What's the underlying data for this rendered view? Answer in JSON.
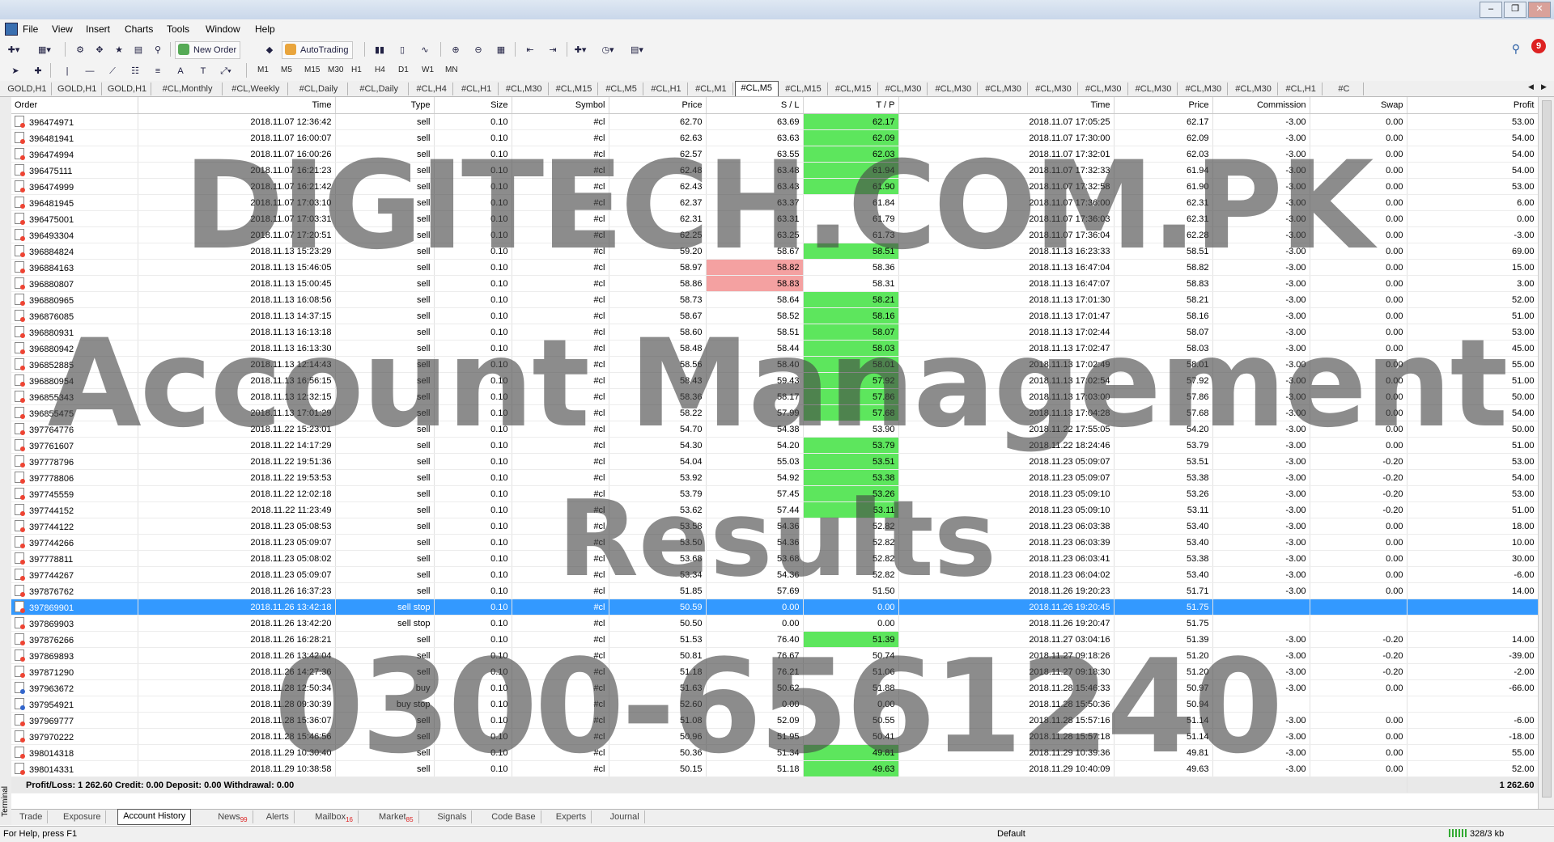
{
  "menu": [
    "File",
    "View",
    "Insert",
    "Charts",
    "Tools",
    "Window",
    "Help"
  ],
  "toolbar": {
    "new_order": "New Order",
    "autotrading": "AutoTrading"
  },
  "timeframes": [
    "M1",
    "M5",
    "M15",
    "M30",
    "H1",
    "H4",
    "D1",
    "W1",
    "MN"
  ],
  "notification_count": "9",
  "chart_tabs": [
    "GOLD,H1",
    "GOLD,H1",
    "GOLD,H1",
    "#CL,Monthly",
    "#CL,Weekly",
    "#CL,Daily",
    "#CL,Daily",
    "#CL,H4",
    "#CL,H1",
    "#CL,M30",
    "#CL,M15",
    "#CL,M5",
    "#CL,H1",
    "#CL,M1",
    "#CL,M5",
    "#CL,M15",
    "#CL,M15",
    "#CL,M30",
    "#CL,M30",
    "#CL,M30",
    "#CL,M30",
    "#CL,M30",
    "#CL,M30",
    "#CL,M30",
    "#CL,M30",
    "#CL,H1",
    "#C"
  ],
  "active_chart_tab": 14,
  "columns": [
    "Order",
    "Time",
    "Type",
    "Size",
    "Symbol",
    "Price",
    "S / L",
    "T / P",
    "Time",
    "Price",
    "Commission",
    "Swap",
    "Profit"
  ],
  "rows": [
    [
      "396474971",
      "2018.11.07 12:36:42",
      "sell",
      "0.10",
      "#cl",
      "62.70",
      "63.69",
      "62.17",
      "2018.11.07 17:05:25",
      "62.17",
      "-3.00",
      "0.00",
      "53.00"
    ],
    [
      "396481941",
      "2018.11.07 16:00:07",
      "sell",
      "0.10",
      "#cl",
      "62.63",
      "63.63",
      "62.09",
      "2018.11.07 17:30:00",
      "62.09",
      "-3.00",
      "0.00",
      "54.00"
    ],
    [
      "396474994",
      "2018.11.07 16:00:26",
      "sell",
      "0.10",
      "#cl",
      "62.57",
      "63.55",
      "62.03",
      "2018.11.07 17:32:01",
      "62.03",
      "-3.00",
      "0.00",
      "54.00"
    ],
    [
      "396475111",
      "2018.11.07 16:21:23",
      "sell",
      "0.10",
      "#cl",
      "62.48",
      "63.48",
      "61.94",
      "2018.11.07 17:32:33",
      "61.94",
      "-3.00",
      "0.00",
      "54.00"
    ],
    [
      "396474999",
      "2018.11.07 16:21:42",
      "sell",
      "0.10",
      "#cl",
      "62.43",
      "63.43",
      "61.90",
      "2018.11.07 17:32:58",
      "61.90",
      "-3.00",
      "0.00",
      "53.00"
    ],
    [
      "396481945",
      "2018.11.07 17:03:10",
      "sell",
      "0.10",
      "#cl",
      "62.37",
      "63.37",
      "61.84",
      "2018.11.07 17:36:00",
      "62.31",
      "-3.00",
      "0.00",
      "6.00"
    ],
    [
      "396475001",
      "2018.11.07 17:03:31",
      "sell",
      "0.10",
      "#cl",
      "62.31",
      "63.31",
      "61.79",
      "2018.11.07 17:36:03",
      "62.31",
      "-3.00",
      "0.00",
      "0.00"
    ],
    [
      "396493304",
      "2018.11.07 17:20:51",
      "sell",
      "0.10",
      "#cl",
      "62.25",
      "63.25",
      "61.73",
      "2018.11.07 17:36:04",
      "62.28",
      "-3.00",
      "0.00",
      "-3.00"
    ],
    [
      "396884824",
      "2018.11.13 15:23:29",
      "sell",
      "0.10",
      "#cl",
      "59.20",
      "58.67",
      "58.51",
      "2018.11.13 16:23:33",
      "58.51",
      "-3.00",
      "0.00",
      "69.00"
    ],
    [
      "396884163",
      "2018.11.13 15:46:05",
      "sell",
      "0.10",
      "#cl",
      "58.97",
      "58.82",
      "58.36",
      "2018.11.13 16:47:04",
      "58.82",
      "-3.00",
      "0.00",
      "15.00"
    ],
    [
      "396880807",
      "2018.11.13 15:00:45",
      "sell",
      "0.10",
      "#cl",
      "58.86",
      "58.83",
      "58.31",
      "2018.11.13 16:47:07",
      "58.83",
      "-3.00",
      "0.00",
      "3.00"
    ],
    [
      "396880965",
      "2018.11.13 16:08:56",
      "sell",
      "0.10",
      "#cl",
      "58.73",
      "58.64",
      "58.21",
      "2018.11.13 17:01:30",
      "58.21",
      "-3.00",
      "0.00",
      "52.00"
    ],
    [
      "396876085",
      "2018.11.13 14:37:15",
      "sell",
      "0.10",
      "#cl",
      "58.67",
      "58.52",
      "58.16",
      "2018.11.13 17:01:47",
      "58.16",
      "-3.00",
      "0.00",
      "51.00"
    ],
    [
      "396880931",
      "2018.11.13 16:13:18",
      "sell",
      "0.10",
      "#cl",
      "58.60",
      "58.51",
      "58.07",
      "2018.11.13 17:02:44",
      "58.07",
      "-3.00",
      "0.00",
      "53.00"
    ],
    [
      "396880942",
      "2018.11.13 16:13:30",
      "sell",
      "0.10",
      "#cl",
      "58.48",
      "58.44",
      "58.03",
      "2018.11.13 17:02:47",
      "58.03",
      "-3.00",
      "0.00",
      "45.00"
    ],
    [
      "396852885",
      "2018.11.13 12:14:43",
      "sell",
      "0.10",
      "#cl",
      "58.56",
      "58.40",
      "58.01",
      "2018.11.13 17:02:49",
      "58.01",
      "-3.00",
      "0.00",
      "55.00"
    ],
    [
      "396880954",
      "2018.11.13 16:56:15",
      "sell",
      "0.10",
      "#cl",
      "58.43",
      "59.43",
      "57.92",
      "2018.11.13 17:02:54",
      "57.92",
      "-3.00",
      "0.00",
      "51.00"
    ],
    [
      "396855343",
      "2018.11.13 12:32:15",
      "sell",
      "0.10",
      "#cl",
      "58.36",
      "58.17",
      "57.86",
      "2018.11.13 17:03:00",
      "57.86",
      "-3.00",
      "0.00",
      "50.00"
    ],
    [
      "396855475",
      "2018.11.13 17:01:29",
      "sell",
      "0.10",
      "#cl",
      "58.22",
      "57.99",
      "57.68",
      "2018.11.13 17:04:28",
      "57.68",
      "-3.00",
      "0.00",
      "54.00"
    ],
    [
      "397764776",
      "2018.11.22 15:23:01",
      "sell",
      "0.10",
      "#cl",
      "54.70",
      "54.38",
      "53.90",
      "2018.11.22 17:55:05",
      "54.20",
      "-3.00",
      "0.00",
      "50.00"
    ],
    [
      "397761607",
      "2018.11.22 14:17:29",
      "sell",
      "0.10",
      "#cl",
      "54.30",
      "54.20",
      "53.79",
      "2018.11.22 18:24:46",
      "53.79",
      "-3.00",
      "0.00",
      "51.00"
    ],
    [
      "397778796",
      "2018.11.22 19:51:36",
      "sell",
      "0.10",
      "#cl",
      "54.04",
      "55.03",
      "53.51",
      "2018.11.23 05:09:07",
      "53.51",
      "-3.00",
      "-0.20",
      "53.00"
    ],
    [
      "397778806",
      "2018.11.22 19:53:53",
      "sell",
      "0.10",
      "#cl",
      "53.92",
      "54.92",
      "53.38",
      "2018.11.23 05:09:07",
      "53.38",
      "-3.00",
      "-0.20",
      "54.00"
    ],
    [
      "397745559",
      "2018.11.22 12:02:18",
      "sell",
      "0.10",
      "#cl",
      "53.79",
      "57.45",
      "53.26",
      "2018.11.23 05:09:10",
      "53.26",
      "-3.00",
      "-0.20",
      "53.00"
    ],
    [
      "397744152",
      "2018.11.22 11:23:49",
      "sell",
      "0.10",
      "#cl",
      "53.62",
      "57.44",
      "53.11",
      "2018.11.23 05:09:10",
      "53.11",
      "-3.00",
      "-0.20",
      "51.00"
    ],
    [
      "397744122",
      "2018.11.23 05:08:53",
      "sell",
      "0.10",
      "#cl",
      "53.58",
      "54.36",
      "52.82",
      "2018.11.23 06:03:38",
      "53.40",
      "-3.00",
      "0.00",
      "18.00"
    ],
    [
      "397744266",
      "2018.11.23 05:09:07",
      "sell",
      "0.10",
      "#cl",
      "53.50",
      "54.36",
      "52.82",
      "2018.11.23 06:03:39",
      "53.40",
      "-3.00",
      "0.00",
      "10.00"
    ],
    [
      "397778811",
      "2018.11.23 05:08:02",
      "sell",
      "0.10",
      "#cl",
      "53.68",
      "53.68",
      "52.82",
      "2018.11.23 06:03:41",
      "53.38",
      "-3.00",
      "0.00",
      "30.00"
    ],
    [
      "397744267",
      "2018.11.23 05:09:07",
      "sell",
      "0.10",
      "#cl",
      "53.34",
      "54.36",
      "52.82",
      "2018.11.23 06:04:02",
      "53.40",
      "-3.00",
      "0.00",
      "-6.00"
    ],
    [
      "397876762",
      "2018.11.26 16:37:23",
      "sell",
      "0.10",
      "#cl",
      "51.85",
      "57.69",
      "51.50",
      "2018.11.26 19:20:23",
      "51.71",
      "-3.00",
      "0.00",
      "14.00"
    ],
    [
      "397869901",
      "2018.11.26 13:42:18",
      "sell stop",
      "0.10",
      "#cl",
      "50.59",
      "0.00",
      "0.00",
      "2018.11.26 19:20:45",
      "51.75",
      "",
      "",
      ""
    ],
    [
      "397869903",
      "2018.11.26 13:42:20",
      "sell stop",
      "0.10",
      "#cl",
      "50.50",
      "0.00",
      "0.00",
      "2018.11.26 19:20:47",
      "51.75",
      "",
      "",
      ""
    ],
    [
      "397876266",
      "2018.11.26 16:28:21",
      "sell",
      "0.10",
      "#cl",
      "51.53",
      "76.40",
      "51.39",
      "2018.11.27 03:04:16",
      "51.39",
      "-3.00",
      "-0.20",
      "14.00"
    ],
    [
      "397869893",
      "2018.11.26 13:42:04",
      "sell",
      "0.10",
      "#cl",
      "50.81",
      "76.67",
      "50.74",
      "2018.11.27 09:18:26",
      "51.20",
      "-3.00",
      "-0.20",
      "-39.00"
    ],
    [
      "397871290",
      "2018.11.26 14:27:36",
      "sell",
      "0.10",
      "#cl",
      "51.18",
      "76.21",
      "51.06",
      "2018.11.27 09:18:30",
      "51.20",
      "-3.00",
      "-0.20",
      "-2.00"
    ],
    [
      "397963672",
      "2018.11.28 12:50:34",
      "buy",
      "0.10",
      "#cl",
      "51.63",
      "50.62",
      "51.88",
      "2018.11.28 15:46:33",
      "50.97",
      "-3.00",
      "0.00",
      "-66.00"
    ],
    [
      "397954921",
      "2018.11.28 09:30:39",
      "buy stop",
      "0.10",
      "#cl",
      "52.60",
      "0.00",
      "0.00",
      "2018.11.28 15:50:36",
      "50.94",
      "",
      "",
      ""
    ],
    [
      "397969777",
      "2018.11.28 15:36:07",
      "sell",
      "0.10",
      "#cl",
      "51.08",
      "52.09",
      "50.55",
      "2018.11.28 15:57:16",
      "51.14",
      "-3.00",
      "0.00",
      "-6.00"
    ],
    [
      "397970222",
      "2018.11.28 15:46:56",
      "sell",
      "0.10",
      "#cl",
      "50.96",
      "51.95",
      "50.41",
      "2018.11.28 15:57:18",
      "51.14",
      "-3.00",
      "0.00",
      "-18.00"
    ],
    [
      "398014318",
      "2018.11.29 10:30:40",
      "sell",
      "0.10",
      "#cl",
      "50.36",
      "51.34",
      "49.81",
      "2018.11.29 10:39:36",
      "49.81",
      "-3.00",
      "0.00",
      "55.00"
    ],
    [
      "398014331",
      "2018.11.29 10:38:58",
      "sell",
      "0.10",
      "#cl",
      "50.15",
      "51.18",
      "49.63",
      "2018.11.29 10:40:09",
      "49.63",
      "-3.00",
      "0.00",
      "52.00"
    ]
  ],
  "tp_hit_rows": [
    0,
    1,
    2,
    3,
    4,
    8,
    11,
    12,
    13,
    14,
    15,
    16,
    17,
    18,
    20,
    21,
    22,
    23,
    24,
    32,
    39,
    40
  ],
  "sl_hit_rows": [
    9,
    10
  ],
  "selected_row": 30,
  "summary": {
    "text": "Profit/Loss: 1 262.60  Credit: 0.00  Deposit: 0.00  Withdrawal: 0.00",
    "total": "1 262.60"
  },
  "side_label": "Terminal",
  "bottom_tabs": [
    {
      "label": "Trade",
      "badge": ""
    },
    {
      "label": "Exposure",
      "badge": ""
    },
    {
      "label": "Account History",
      "badge": ""
    },
    {
      "label": "News",
      "badge": "99"
    },
    {
      "label": "Alerts",
      "badge": ""
    },
    {
      "label": "Mailbox",
      "badge": "16"
    },
    {
      "label": "Market",
      "badge": "85"
    },
    {
      "label": "Signals",
      "badge": ""
    },
    {
      "label": "Code Base",
      "badge": ""
    },
    {
      "label": "Experts",
      "badge": ""
    },
    {
      "label": "Journal",
      "badge": ""
    }
  ],
  "active_bottom_tab": 2,
  "status": {
    "help": "For Help, press F1",
    "profile": "Default",
    "traffic": "328/3 kb"
  },
  "watermark": {
    "line1": "DIGITECH.COM.PK",
    "line2": "Account Management",
    "line3": "Results",
    "line4": "0300-6561240"
  },
  "colors": {
    "tp_hit": "#5de65d",
    "sl_hit": "#f4a1a1",
    "selected": "#3399ff"
  }
}
